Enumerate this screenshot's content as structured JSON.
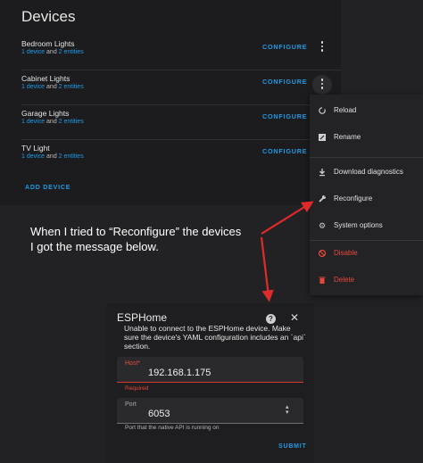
{
  "devices_card": {
    "title": "Devices",
    "rows": [
      {
        "name": "Bedroom Lights",
        "devices": "1 device",
        "and": "and",
        "entities": "2 entities",
        "action": "CONFIGURE"
      },
      {
        "name": "Cabinet Lights",
        "devices": "1 device",
        "and": "and",
        "entities": "2 entities",
        "action": "CONFIGURE"
      },
      {
        "name": "Garage Lights",
        "devices": "1 device",
        "and": "and",
        "entities": "2 entities",
        "action": "CONFIGURE"
      },
      {
        "name": "TV Light",
        "devices": "1 device",
        "and": "and",
        "entities": "2 entities",
        "action": "CONFIGURE"
      }
    ],
    "add_device": "ADD DEVICE"
  },
  "overflow_menu": {
    "items": [
      {
        "label": "Reload",
        "icon": "reload-icon"
      },
      {
        "label": "Rename",
        "icon": "rename-icon"
      },
      {
        "label": "Download diagnostics",
        "icon": "download-icon"
      },
      {
        "label": "Reconfigure",
        "icon": "wrench-icon"
      },
      {
        "label": "System options",
        "icon": "gear-icon"
      },
      {
        "label": "Disable",
        "icon": "disable-icon",
        "color": "#e8483b"
      },
      {
        "label": "Delete",
        "icon": "trash-icon",
        "color": "#e8483b"
      }
    ]
  },
  "annotation": {
    "line1": "When I tried to “Reconfigure” the devices",
    "line2": "I got the message below.",
    "arrow_color": "#e02a2a"
  },
  "dialog": {
    "title": "ESPHome",
    "message": "Unable to connect to the ESPHome device. Make sure the device's YAML configuration includes an `api` section.",
    "host_label": "Host*",
    "host_value": "192.168.1.175",
    "host_error": "Required",
    "port_label": "Port",
    "port_value": "6053",
    "port_helper": "Port that the native API is running on",
    "submit": "SUBMIT"
  },
  "colors": {
    "accent": "#1e9be6",
    "error": "#e8483b",
    "background": "#222225"
  }
}
